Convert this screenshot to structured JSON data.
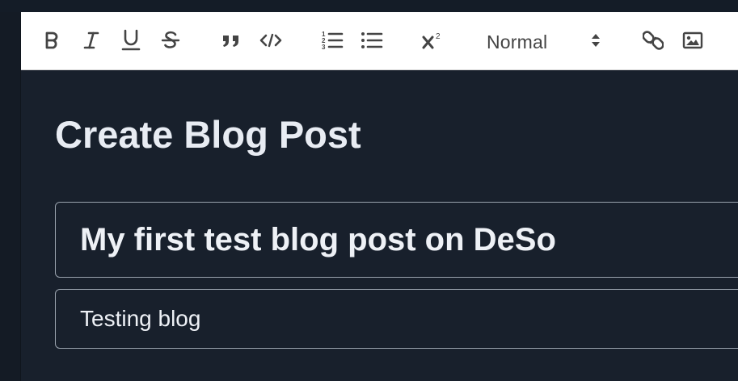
{
  "toolbar": {
    "buttons": [
      {
        "name": "bold",
        "icon": "bold-icon"
      },
      {
        "name": "italic",
        "icon": "italic-icon"
      },
      {
        "name": "underline",
        "icon": "underline-icon"
      },
      {
        "name": "strike",
        "icon": "strikethrough-icon"
      },
      {
        "name": "blockquote",
        "icon": "quote-icon"
      },
      {
        "name": "code-block",
        "icon": "code-icon"
      },
      {
        "name": "ordered-list",
        "icon": "ordered-list-icon"
      },
      {
        "name": "bullet-list",
        "icon": "bullet-list-icon"
      },
      {
        "name": "superscript",
        "icon": "superscript-icon"
      },
      {
        "name": "link",
        "icon": "link-icon"
      },
      {
        "name": "image",
        "icon": "image-icon"
      }
    ],
    "header_select": {
      "value": "Normal"
    },
    "icon_color": "#444444"
  },
  "page": {
    "title": "Create Blog Post"
  },
  "form": {
    "title_value": "My first test blog post on DeSo",
    "subtitle_value": "Testing blog"
  },
  "colors": {
    "background": "#18202c",
    "toolbar_background": "#ffffff",
    "input_border": "#9aa3ae",
    "text": "#eef1f6"
  }
}
